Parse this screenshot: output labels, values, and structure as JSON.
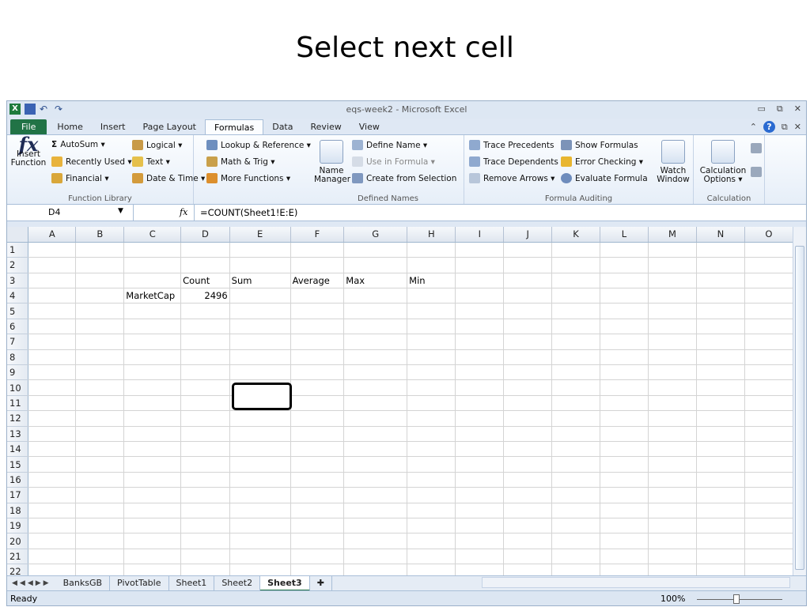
{
  "slide_title": "Select next cell",
  "window": {
    "title": "eqs-week2 - Microsoft Excel",
    "controls": [
      "▭",
      "⧉",
      "✕"
    ]
  },
  "ribbon_tabs": [
    "File",
    "Home",
    "Insert",
    "Page Layout",
    "Formulas",
    "Data",
    "Review",
    "View"
  ],
  "active_tab": "Formulas",
  "groups": {
    "function_library": {
      "label": "Function Library",
      "insert_function": "Insert Function",
      "autosum": "AutoSum ▾",
      "recently_used": "Recently Used ▾",
      "financial": "Financial ▾",
      "logical": "Logical ▾",
      "text": "Text ▾",
      "date_time": "Date & Time ▾",
      "lookup": "Lookup & Reference ▾",
      "math": "Math & Trig ▾",
      "more": "More Functions ▾"
    },
    "defined_names": {
      "label": "Defined Names",
      "name_manager": "Name Manager",
      "define_name": "Define Name ▾",
      "use_in_formula": "Use in Formula ▾",
      "create_from_selection": "Create from Selection"
    },
    "formula_auditing": {
      "label": "Formula Auditing",
      "trace_precedents": "Trace Precedents",
      "trace_dependents": "Trace Dependents",
      "remove_arrows": "Remove Arrows ▾",
      "show_formulas": "Show Formulas",
      "error_checking": "Error Checking ▾",
      "evaluate_formula": "Evaluate Formula",
      "watch_window": "Watch Window"
    },
    "calculation": {
      "label": "Calculation",
      "options": "Calculation Options ▾"
    }
  },
  "formula_bar": {
    "name_box": "D4",
    "fx": "fx",
    "formula": "=COUNT(Sheet1!E:E)"
  },
  "columns": [
    "A",
    "B",
    "C",
    "D",
    "E",
    "F",
    "G",
    "H",
    "I",
    "J",
    "K",
    "L",
    "M",
    "N",
    "O"
  ],
  "rows": [
    "1",
    "2",
    "3",
    "4",
    "5",
    "6",
    "7",
    "8",
    "9",
    "10",
    "11",
    "12",
    "13",
    "14",
    "15",
    "16",
    "17",
    "18",
    "19",
    "20",
    "21",
    "22"
  ],
  "cells": {
    "C4": "MarketCap",
    "D3": "Count",
    "D4": "2496",
    "E3": "Sum",
    "F3": "Average",
    "G3": "Max",
    "H3": "Min"
  },
  "sheet_tabs": [
    "BanksGB",
    "PivotTable",
    "Sheet1",
    "Sheet2",
    "Sheet3"
  ],
  "active_sheet": "Sheet3",
  "status": {
    "ready": "Ready",
    "zoom": "100%"
  }
}
